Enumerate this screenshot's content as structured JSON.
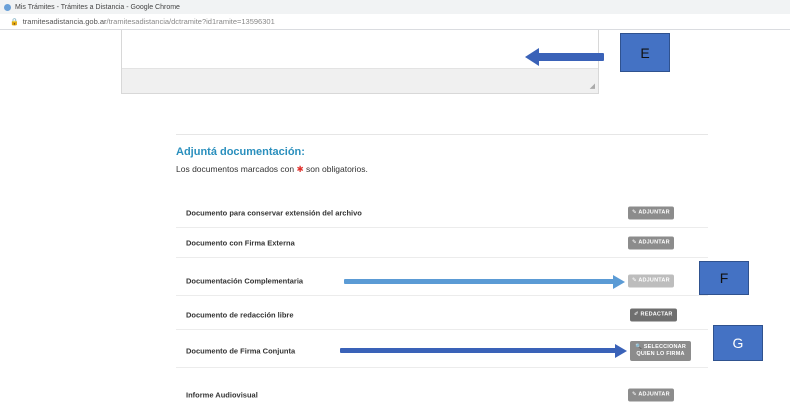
{
  "browser": {
    "window_title": "Mis Trámites - Trámites a Distancia - Google Chrome",
    "url_host": "tramitesadistancia.gob.ar",
    "url_path": "/tramitesadistancia/dctramite?id1ramite=13596301"
  },
  "section": {
    "title": "Adjuntá documentación:",
    "subtitle_prefix": "Los documentos marcados con ",
    "required_marker": "✱",
    "subtitle_suffix": " son obligatorios."
  },
  "documents": [
    {
      "label": "Documento para conservar extensión del archivo",
      "button": "✎ ADJUNTAR"
    },
    {
      "label": "Documento con Firma Externa",
      "button": "✎ ADJUNTAR"
    },
    {
      "label": "Documentación Complementaria",
      "button": "✎ ADJUNTAR"
    },
    {
      "label": "Documento de redacción libre",
      "button": "✐ REDACTAR"
    },
    {
      "label": "Documento de Firma Conjunta",
      "button_line1": "🔍 SELECCIONAR",
      "button_line2": "QUIEN LO FIRMA"
    },
    {
      "label": "Informe Audiovisual",
      "button": "✎ ADJUNTAR"
    }
  ],
  "annotations": {
    "E": "E",
    "F": "F",
    "G": "G"
  },
  "colors": {
    "arrow_light": "#5b9bd5",
    "arrow_dark": "#3a62b8",
    "callout": "#4472c4",
    "section_title": "#2a8fbd",
    "required": "#e0302b"
  }
}
